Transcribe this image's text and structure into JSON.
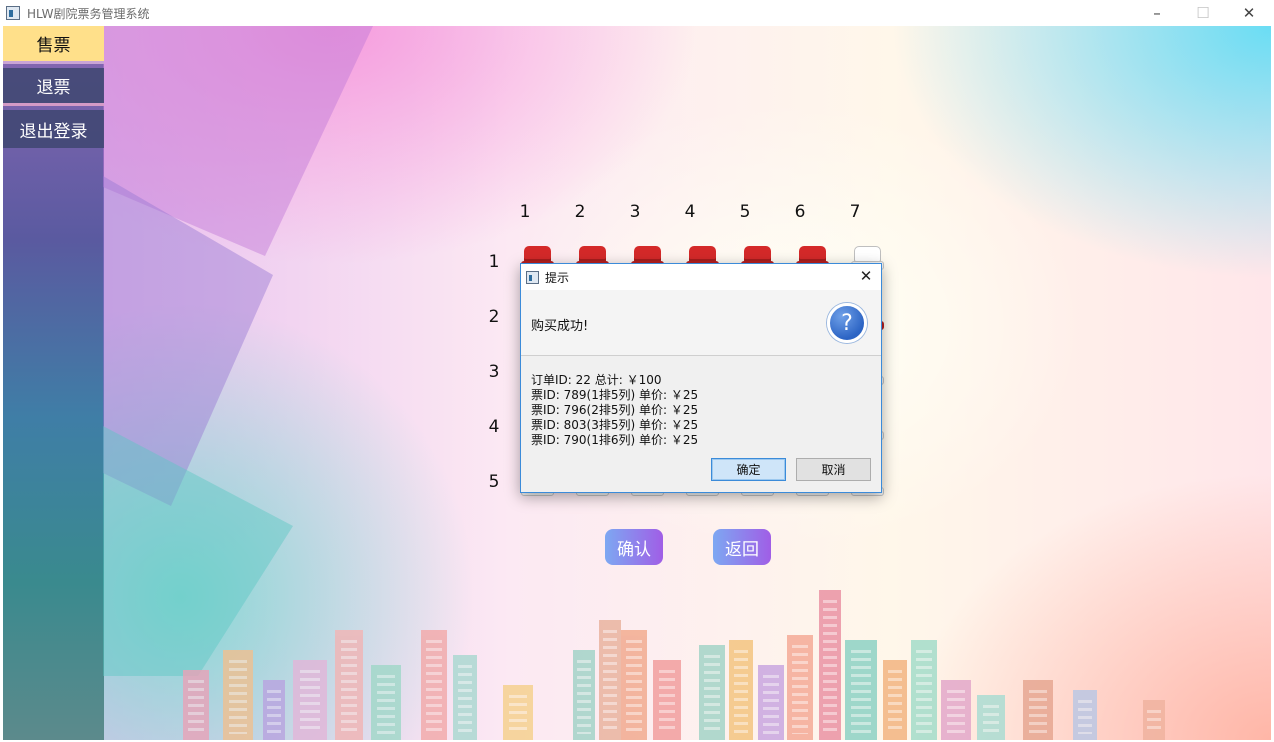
{
  "window": {
    "title": "HLW剧院票务管理系统"
  },
  "nav": [
    {
      "label": "售票",
      "selected": true
    },
    {
      "label": "退票",
      "selected": false
    },
    {
      "label": "退出登录",
      "selected": false
    }
  ],
  "seatmap": {
    "columns": [
      "1",
      "2",
      "3",
      "4",
      "5",
      "6",
      "7"
    ],
    "rows": [
      "1",
      "2",
      "3",
      "4",
      "5"
    ],
    "row1_status": [
      "sold",
      "sold",
      "sold",
      "sold",
      "sold",
      "sold",
      "available"
    ],
    "row2_col7_status": "sold",
    "row3_col7_status": "available",
    "row4_col7_status": "available",
    "row5_status": [
      "available",
      "available",
      "available",
      "available",
      "available",
      "available",
      "available"
    ],
    "colors": {
      "sold": "#d42929",
      "available": "#ffffff"
    }
  },
  "actions": {
    "confirm_label": "确认",
    "back_label": "返回"
  },
  "dialog": {
    "title": "提示",
    "message": "购买成功!",
    "details": [
      "订单ID: 22 总计: ￥100",
      "票ID: 789(1排5列) 单价: ￥25",
      "票ID: 796(2排5列) 单价: ￥25",
      "票ID: 803(3排5列) 单价: ￥25",
      "票ID: 790(1排6列) 单价: ￥25"
    ],
    "ok_label": "确定",
    "cancel_label": "取消",
    "icon": "question-icon"
  }
}
